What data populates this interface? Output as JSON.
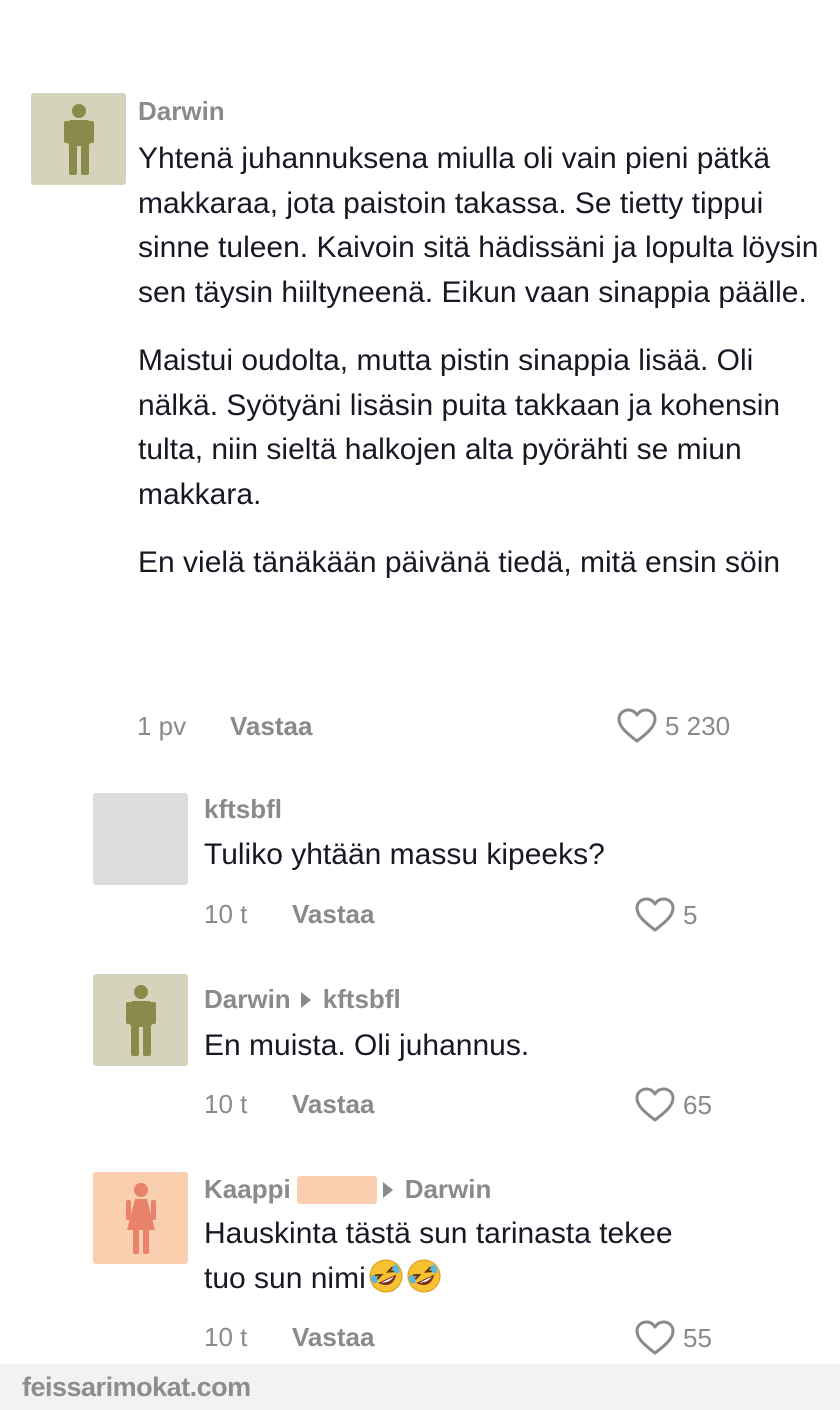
{
  "comments": [
    {
      "username": "Darwin",
      "paragraphs": [
        "Yhtenä juhannuksena miulla oli vain pieni pätkä makkaraa, jota paistoin takassa. Se tietty tippui sinne tuleen. Kaivoin sitä hädissäni ja lopulta löysin sen täysin hiiltyneenä. Eikun vaan sinappia päälle.",
        "Maistui oudolta, mutta pistin sinappia lisää. Oli nälkä. Syötyäni lisäsin puita takkaan ja kohensin tulta, niin sieltä halkojen alta pyörähti se miun makkara.",
        "En vielä tänäkään päivänä tiedä, mitä ensin söin"
      ],
      "time": "1 pv",
      "reply_label": "Vastaa",
      "likes": "5 230",
      "avatar_icon": "man-icon",
      "avatar_color": "#d6d3bd"
    },
    {
      "username": "kftsbfl",
      "text": "Tuliko yhtään massu kipeeks?",
      "time": "10 t",
      "reply_label": "Vastaa",
      "likes": "5",
      "avatar_color": "#dcdcdc"
    },
    {
      "username": "Darwin",
      "reply_to": "kftsbfl",
      "text": "En muista. Oli juhannus.",
      "time": "10 t",
      "reply_label": "Vastaa",
      "likes": "65",
      "avatar_icon": "man-icon",
      "avatar_color": "#d6d3bd"
    },
    {
      "username": "Kaappi",
      "reply_to": "Darwin",
      "text_line1": "Hauskinta tästä sun tarinasta tekee",
      "text_line2": "tuo sun nimi",
      "emojis": "🤣🤣",
      "time": "10 t",
      "reply_label": "Vastaa",
      "likes": "55",
      "avatar_icon": "woman-icon",
      "avatar_color": "#f9cfb0"
    }
  ],
  "watermark": "feissarimokat.com",
  "colors": {
    "text": "#161823",
    "muted": "#8a8a8a",
    "man_figure": "#8a8a4a",
    "woman_figure": "#e8826a"
  }
}
